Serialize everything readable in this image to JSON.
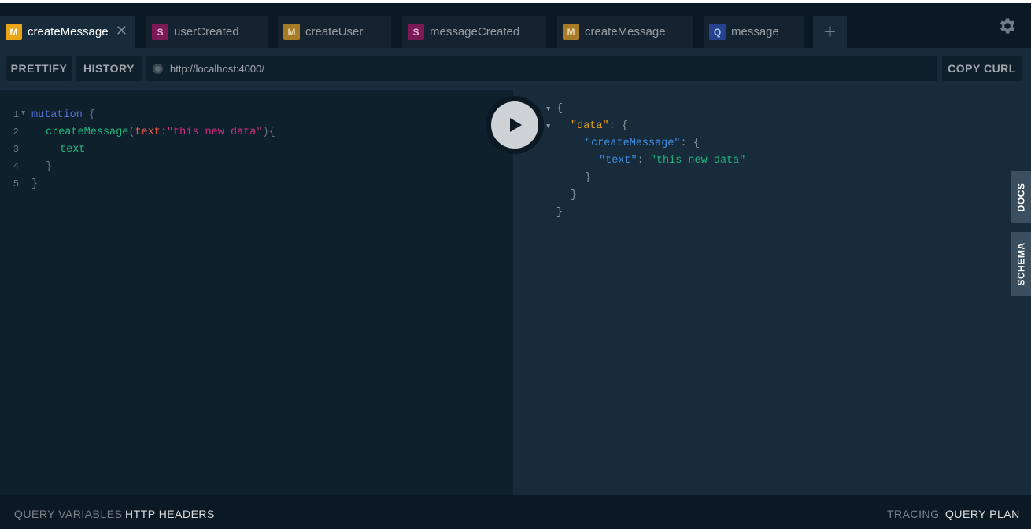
{
  "tabs": [
    {
      "type": "M",
      "label": "createMessage",
      "active": true,
      "closable": true
    },
    {
      "type": "S",
      "label": "userCreated"
    },
    {
      "type": "M",
      "label": "createUser"
    },
    {
      "type": "S",
      "label": "messageCreated"
    },
    {
      "type": "M",
      "label": "createMessage"
    },
    {
      "type": "Q",
      "label": "message"
    }
  ],
  "add_tab_icon": "plus-icon",
  "settings_icon": "gear-icon",
  "toolbar": {
    "prettify": "PRETTIFY",
    "history": "HISTORY",
    "url": "http://localhost:4000/",
    "copy_curl": "COPY CURL"
  },
  "editor": {
    "line_numbers": [
      "1",
      "2",
      "3",
      "4",
      "5"
    ],
    "lines": {
      "l1_kw": "mutation",
      "l1_brace": "{",
      "l2_fn": "createMessage",
      "l2_open": "(",
      "l2_arg": "text",
      "l2_colon": ":",
      "l2_str": "\"this new data\"",
      "l2_close": "){",
      "l3_field": "text",
      "l4_brace": "}",
      "l5_brace": "}"
    }
  },
  "result": {
    "open": "{",
    "data_key": "\"data\"",
    "colon": ":",
    "brace_open": "{",
    "create_key": "\"createMessage\"",
    "text_key": "\"text\"",
    "text_val": "\"this new data\"",
    "close": "}"
  },
  "sidebar": {
    "docs": "DOCS",
    "schema": "SCHEMA"
  },
  "bottom": {
    "query_variables": "QUERY VARIABLES",
    "http_headers": "HTTP HEADERS",
    "tracing": "TRACING",
    "query_plan": "QUERY PLAN"
  }
}
